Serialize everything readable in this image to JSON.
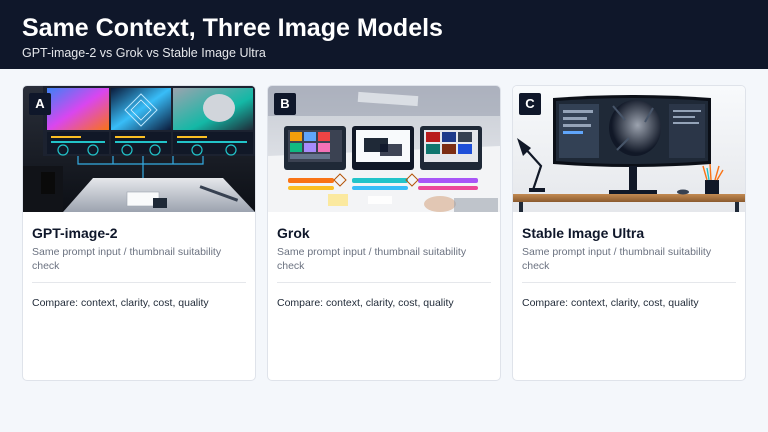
{
  "header": {
    "title": "Same Context, Three Image Models",
    "subtitle": "GPT-image-2 vs Grok vs Stable Image Ultra"
  },
  "cards": [
    {
      "badge": "A",
      "name": "GPT-image-2",
      "description": "Same prompt input / thumbnail suitability check",
      "compare": "Compare: context, clarity, cost, quality"
    },
    {
      "badge": "B",
      "name": "Grok",
      "description": "Same prompt input / thumbnail suitability check",
      "compare": "Compare: context, clarity, cost, quality"
    },
    {
      "badge": "C",
      "name": "Stable Image Ultra",
      "description": "Same prompt input / thumbnail suitability check",
      "compare": "Compare: context, clarity, cost, quality"
    }
  ],
  "colors": {
    "header_bg": "#0f172a",
    "page_bg": "#f4f7fb",
    "card_border": "#dfe3ea",
    "accent_teal": "#22c4c9"
  }
}
